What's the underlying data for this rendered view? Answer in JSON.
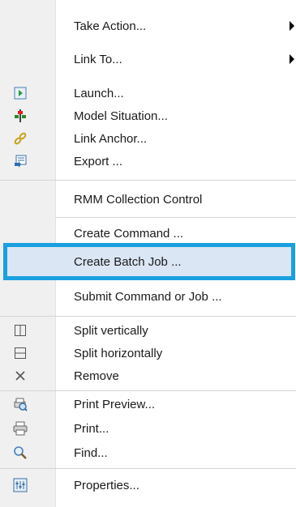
{
  "menu": {
    "items": [
      {
        "label": "Take Action...",
        "icon": "",
        "submenu": true
      },
      {
        "label": "Link To...",
        "icon": "",
        "submenu": true
      },
      {
        "label": "Launch...",
        "icon": "launch-icon"
      },
      {
        "label": "Model Situation...",
        "icon": "model-situation-icon"
      },
      {
        "label": "Link Anchor...",
        "icon": "link-anchor-icon"
      },
      {
        "label": "Export ...",
        "icon": "export-icon"
      },
      {
        "label": "RMM Collection Control",
        "icon": ""
      },
      {
        "label": "Create Command ...",
        "icon": ""
      },
      {
        "label": "Create Batch Job ...",
        "icon": "",
        "highlighted": true
      },
      {
        "label": "Submit Command or Job ...",
        "icon": ""
      },
      {
        "label": "Split vertically",
        "icon": "split-vertical-icon"
      },
      {
        "label": "Split horizontally",
        "icon": "split-horizontal-icon"
      },
      {
        "label": "Remove",
        "icon": "remove-icon"
      },
      {
        "label": "Print Preview...",
        "icon": "print-preview-icon"
      },
      {
        "label": "Print...",
        "icon": "printer-icon"
      },
      {
        "label": "Find...",
        "icon": "magnifier-icon"
      },
      {
        "label": "Properties...",
        "icon": "properties-icon"
      }
    ]
  },
  "colors": {
    "highlight_border": "#1aa0e0",
    "highlight_fill": "#dbe6f4",
    "gutter": "#f0f0f0"
  }
}
